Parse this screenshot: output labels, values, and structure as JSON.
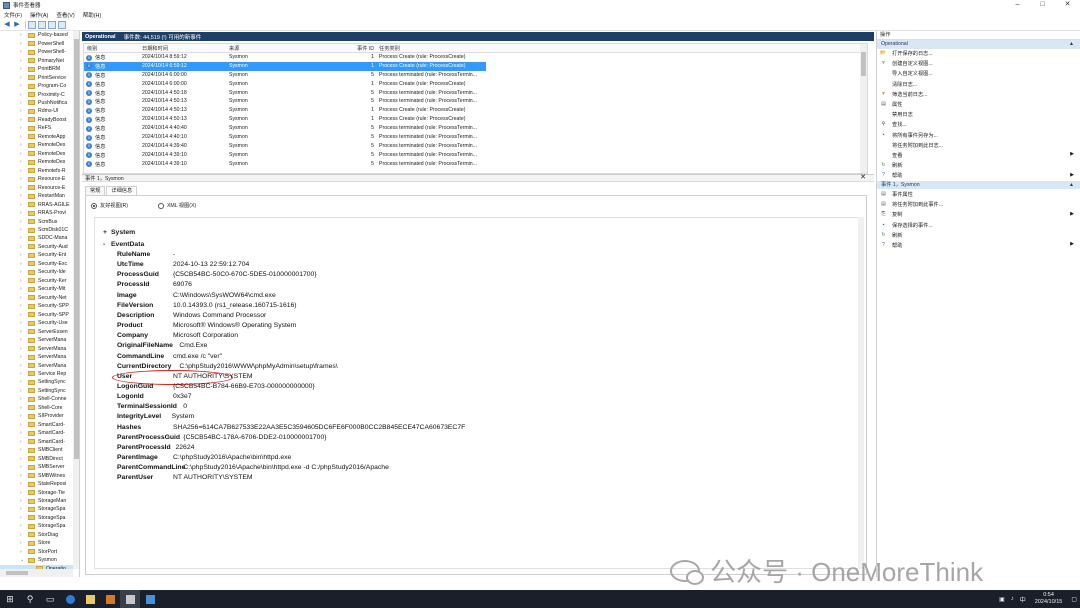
{
  "window": {
    "title": "事件查看器",
    "controls": [
      "–",
      "□",
      "✕"
    ]
  },
  "menu": [
    "文件(F)",
    "操作(A)",
    "查看(V)",
    "帮助(H)"
  ],
  "tree": {
    "items": [
      "Policy-based",
      "PowerShell",
      "PowerShell-",
      "PrimaryNet",
      "PrintBRM",
      "PrintService",
      "Program-Co",
      "Proximity-C",
      "PushNotifica",
      "Rdms-UI",
      "ReadyBoost",
      "ReFS",
      "RemoteApp",
      "RemoteDes",
      "RemoteDes",
      "RemoteDes",
      "Remotefs-R",
      "Resource-E",
      "Resource-E",
      "RestartMan",
      "RRAS-AGILE",
      "RRAS-Provi",
      "ScmBus",
      "ScmDisk01C",
      "SDDC-Mana",
      "Security-Aud",
      "Security-Ent",
      "Security-Exc",
      "Security-Ide",
      "Security-Ker",
      "Security-Mit",
      "Security-Net",
      "Security-SPP",
      "Security-SPP",
      "Security-Use",
      "ServerEssen",
      "ServerMana",
      "ServerMana",
      "ServerMana",
      "ServerMana",
      "Service Rep",
      "SettingSync",
      "SettingSync",
      "Shell-Conne",
      "Shell-Core",
      "SIIProvider",
      "SmartCard-",
      "SmartCard-",
      "SmartCard-",
      "SMBClient",
      "SMBDirect",
      "SMBServer",
      "SMBWitnes",
      "StateReposi",
      "Storage-Tie",
      "StorageMan",
      "StorageSpa",
      "StorageSpa",
      "StorageSpa",
      "StorDiag",
      "Store",
      "StorPort",
      "Sysmon",
      "Operatio"
    ],
    "selected_index": 63
  },
  "events": {
    "log_name": "Operational",
    "count_text": "事件数: 44,519 (!) 可用的新事件",
    "columns": [
      "级别",
      "日期和时间",
      "来源",
      "事件 ID",
      "任务类别"
    ],
    "rows": [
      {
        "level": "信息",
        "datetime": "2024/10/14 8:59:12",
        "source": "Sysmon",
        "id": "1",
        "task": "Process Create (rule: ProcessCreate)"
      },
      {
        "level": "信息",
        "datetime": "2024/10/14 6:59:12",
        "source": "Sysmon",
        "id": "1",
        "task": "Process Create (rule: ProcessCreate)"
      },
      {
        "level": "信息",
        "datetime": "2024/10/14 6:00:00",
        "source": "Sysmon",
        "id": "5",
        "task": "Process terminated (rule: ProcessTermin..."
      },
      {
        "level": "信息",
        "datetime": "2024/10/14 6:00:00",
        "source": "Sysmon",
        "id": "1",
        "task": "Process Create (rule: ProcessCreate)"
      },
      {
        "level": "信息",
        "datetime": "2024/10/14 4:50:18",
        "source": "Sysmon",
        "id": "5",
        "task": "Process terminated (rule: ProcessTermin..."
      },
      {
        "level": "信息",
        "datetime": "2024/10/14 4:50:13",
        "source": "Sysmon",
        "id": "5",
        "task": "Process terminated (rule: ProcessTermin..."
      },
      {
        "level": "信息",
        "datetime": "2024/10/14 4:50:13",
        "source": "Sysmon",
        "id": "1",
        "task": "Process Create (rule: ProcessCreate)"
      },
      {
        "level": "信息",
        "datetime": "2024/10/14 4:50:13",
        "source": "Sysmon",
        "id": "1",
        "task": "Process Create (rule: ProcessCreate)"
      },
      {
        "level": "信息",
        "datetime": "2024/10/14 4:40:40",
        "source": "Sysmon",
        "id": "5",
        "task": "Process terminated (rule: ProcessTermin..."
      },
      {
        "level": "信息",
        "datetime": "2024/10/14 4:40:10",
        "source": "Sysmon",
        "id": "5",
        "task": "Process terminated (rule: ProcessTermin..."
      },
      {
        "level": "信息",
        "datetime": "2024/10/14 4:39:40",
        "source": "Sysmon",
        "id": "5",
        "task": "Process terminated (rule: ProcessTermin..."
      },
      {
        "level": "信息",
        "datetime": "2024/10/14 4:39:10",
        "source": "Sysmon",
        "id": "5",
        "task": "Process terminated (rule: ProcessTermin..."
      },
      {
        "level": "信息",
        "datetime": "2024/10/14 4:39:10",
        "source": "Sysmon",
        "id": "5",
        "task": "Process terminated (rule: ProcessTermin..."
      }
    ],
    "selected_index": 1
  },
  "detail": {
    "header": "事件 1，Sysmon",
    "close": "✕",
    "tabs": [
      "常规",
      "详细信息"
    ],
    "active_tab": 1,
    "radios": [
      "友好视图(R)",
      "XML 视图(X)"
    ],
    "selected_radio": 0,
    "sections": {
      "system": "System",
      "eventdata": "EventData",
      "expand": "+",
      "collapse": "-"
    },
    "fields": [
      {
        "key": "RuleName",
        "value": "-"
      },
      {
        "key": "UtcTime",
        "value": "2024-10-13 22:59:12.704"
      },
      {
        "key": "ProcessGuid",
        "value": "{C5CB54BC-50C0-670C-5DE5-010000001700}"
      },
      {
        "key": "ProcessId",
        "value": "69076"
      },
      {
        "key": "Image",
        "value": "C:\\Windows\\SysWOW64\\cmd.exe"
      },
      {
        "key": "FileVersion",
        "value": "10.0.14393.0 (rs1_release.160715-1616)"
      },
      {
        "key": "Description",
        "value": "Windows Command Processor"
      },
      {
        "key": "Product",
        "value": "Microsoft® Windows® Operating System"
      },
      {
        "key": "Company",
        "value": "Microsoft Corporation"
      },
      {
        "key": "OriginalFileName",
        "value": "Cmd.Exe"
      },
      {
        "key": "CommandLine",
        "value": "cmd.exe /c \"ver\""
      },
      {
        "key": "CurrentDirectory",
        "value": "C:\\phpStudy2016\\WWW\\phpMyAdmin\\setup\\frames\\"
      },
      {
        "key": "User",
        "value": "NT AUTHORITY\\SYSTEM"
      },
      {
        "key": "LogonGuid",
        "value": "{C5CB54BC-B784-66B9-E703-000000000000}"
      },
      {
        "key": "LogonId",
        "value": "0x3e7"
      },
      {
        "key": "TerminalSessionId",
        "value": "0"
      },
      {
        "key": "IntegrityLevel",
        "value": "System"
      },
      {
        "key": "Hashes",
        "value": "SHA256=614CA7B627533E22AA3E5C3594605DC6FE6F000B0CC2B845ECE47CA60673EC7F"
      },
      {
        "key": "ParentProcessGuid",
        "value": "{C5CB54BC-178A-6706-DDE2-010000001700}"
      },
      {
        "key": "ParentProcessId",
        "value": "22624"
      },
      {
        "key": "ParentImage",
        "value": "C:\\phpStudy2016\\Apache\\bin\\httpd.exe"
      },
      {
        "key": "ParentCommandLine",
        "value": "C:\\phpStudy2016\\Apache\\bin\\httpd.exe -d C:/phpStudy2016/Apache"
      },
      {
        "key": "ParentUser",
        "value": "NT AUTHORITY\\SYSTEM"
      }
    ],
    "highlight_key": "CommandLine"
  },
  "actions": {
    "title": "操作",
    "group1": "Operational",
    "group1_items": [
      {
        "icon": "open-log-icon",
        "label": "打开保存的日志..."
      },
      {
        "icon": "filter-icon",
        "label": "创建自定义视图..."
      },
      {
        "icon": "",
        "label": "导入自定义视图..."
      },
      {
        "icon": "",
        "label": "清除日志..."
      },
      {
        "icon": "filter-icon",
        "label": "筛选当前日志..."
      },
      {
        "icon": "properties-icon",
        "label": "属性"
      },
      {
        "icon": "",
        "label": "禁用日志"
      },
      {
        "icon": "find-icon",
        "label": "查找..."
      },
      {
        "icon": "save-icon",
        "label": "将所有事件另存为..."
      },
      {
        "icon": "",
        "label": "将任务附加到此日志..."
      },
      {
        "icon": "",
        "label": "查看",
        "submenu": true
      },
      {
        "icon": "refresh-icon",
        "label": "刷新"
      },
      {
        "icon": "help-icon",
        "label": "帮助",
        "submenu": true
      }
    ],
    "group2": "事件 1，Sysmon",
    "group2_items": [
      {
        "icon": "properties-icon",
        "label": "事件属性"
      },
      {
        "icon": "task-icon",
        "label": "将任务附加到此事件..."
      },
      {
        "icon": "copy-icon",
        "label": "复制",
        "submenu": true
      },
      {
        "icon": "save-icon",
        "label": "保存选择的事件..."
      },
      {
        "icon": "refresh-icon",
        "label": "刷新"
      },
      {
        "icon": "help-icon",
        "label": "帮助",
        "submenu": true
      }
    ]
  },
  "watermark": {
    "text": "公众号 · OneMoreThink"
  },
  "taskbar": {
    "time": "0:54",
    "date": "2024/10/15",
    "ime": "中",
    "apps": [
      "windows-start-icon",
      "search-icon",
      "task-view-icon",
      "edge-icon",
      "explorer-icon",
      "app-icon",
      "event-viewer-icon",
      "network-icon"
    ]
  },
  "colors": {
    "header_bar": "#1e3f66",
    "selection": "#3399ff",
    "highlight_circle": "#e0201b",
    "taskbar": "#1b1f2a"
  }
}
